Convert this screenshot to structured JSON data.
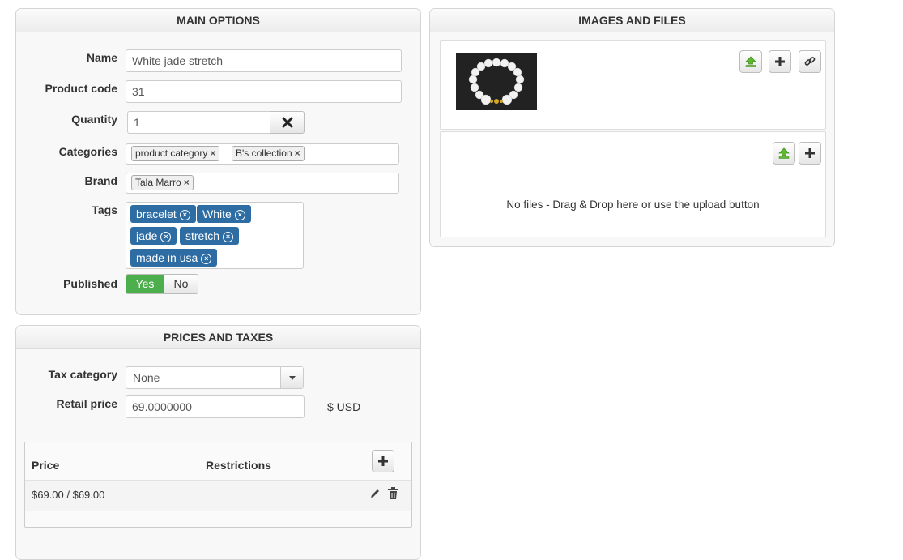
{
  "main_options": {
    "title": "MAIN OPTIONS",
    "name_label": "Name",
    "name_value": "White jade stretch",
    "code_label": "Product code",
    "code_value": "31",
    "quantity_label": "Quantity",
    "quantity_value": "1",
    "categories_label": "Categories",
    "categories": [
      "product category",
      "B's collection"
    ],
    "brand_label": "Brand",
    "brand": "Tala Marro",
    "tags_label": "Tags",
    "tags": [
      "bracelet",
      "White",
      "jade",
      "stretch",
      "made in usa"
    ],
    "published_label": "Published",
    "published_yes": "Yes",
    "published_no": "No"
  },
  "prices": {
    "title": "PRICES AND TAXES",
    "tax_label": "Tax category",
    "tax_value": "None",
    "retail_label": "Retail price",
    "retail_value": "69.0000000",
    "currency": "$ USD",
    "table": {
      "col_price": "Price",
      "col_restrictions": "Restrictions",
      "rows": [
        {
          "price": "$69.00 / $69.00",
          "restrictions": ""
        }
      ]
    }
  },
  "images_files": {
    "title": "IMAGES AND FILES",
    "no_files_text": "No files - Drag & Drop here or use the upload button"
  },
  "icons": {
    "upload": "upload-icon",
    "add": "plus-icon",
    "link": "link-icon",
    "clear": "close-icon",
    "edit": "pencil-icon",
    "delete": "trash-icon",
    "dropdown": "caret-down-icon"
  },
  "colors": {
    "tag_blue": "#2e6da4",
    "toggle_green": "#4cae4c",
    "upload_green": "#5cb82c"
  }
}
